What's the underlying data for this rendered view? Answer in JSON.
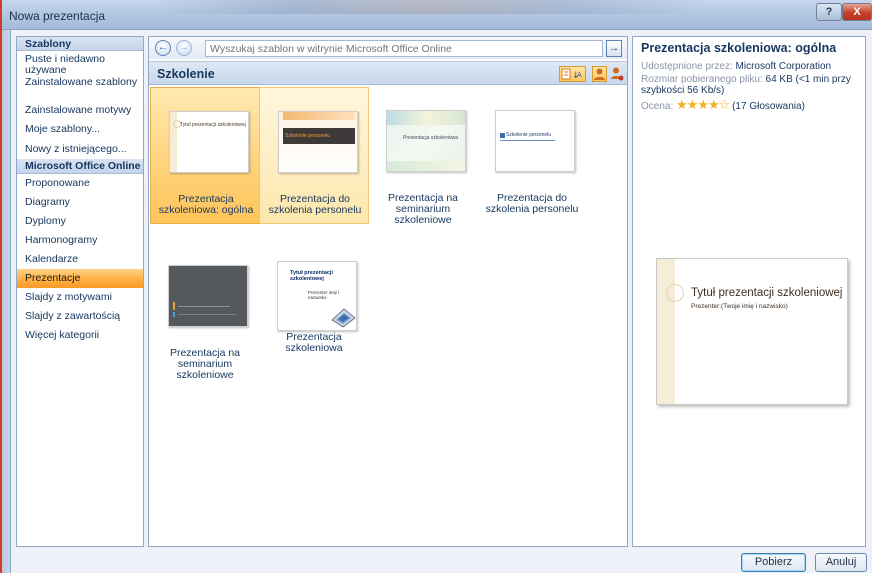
{
  "window": {
    "title": "Nowa prezentacja",
    "help": "?",
    "close": "X"
  },
  "nav": {
    "header1": "Szablony",
    "items1": [
      "Puste i niedawno używane",
      "Zainstalowane szablony",
      "Zainstalowane motywy",
      "Moje szablony...",
      "Nowy z istniejącego..."
    ],
    "header2": "Microsoft Office Online",
    "items2": [
      "Proponowane",
      "Diagramy",
      "Dyplomy",
      "Harmonogramy",
      "Kalendarze",
      "Prezentacje",
      "Slajdy z motywami",
      "Slajdy z zawartością",
      "Więcej kategorii"
    ],
    "selected": "Prezentacje"
  },
  "toolbar": {
    "back": "←",
    "forward": "→",
    "search_placeholder": "Wyszukaj szablon w witrynie Microsoft Office Online",
    "go": "→"
  },
  "section": {
    "title": "Szkolenie"
  },
  "templates": [
    {
      "label": "Prezentacja szkoleniowa: ogólna"
    },
    {
      "label": "Prezentacja do szkolenia personelu"
    },
    {
      "label": "Prezentacja na seminarium szkoleniowe"
    },
    {
      "label": "Prezentacja do szkolenia personelu"
    },
    {
      "label": "Prezentacja na seminarium szkoleniowe"
    },
    {
      "label": "Prezentacja szkoleniowa"
    }
  ],
  "thumbs": {
    "t1_title": "Tytuł prezentacji szkoleniowej",
    "t2_bar": "Szkolenie personelu",
    "t3_title": "Prezentacja szkoleniowa",
    "t4_title": "Szkolenie personelu",
    "t6_title": "Tytuł prezentacji szkoleniowej",
    "t6_sub": "Prezenter imię i nazwisko"
  },
  "details": {
    "title": "Prezentacja szkoleniowa: ogólna",
    "provided_label": "Udostępnione przez:",
    "provided_value": "Microsoft Corporation",
    "size_label": "Rozmiar pobieranego pliku:",
    "size_value": "64 KB (<1 min przy szybkości 56 Kb/s)",
    "rating_label": "Ocena:",
    "rating_stars": "★★★★☆",
    "rating_votes": "(17 Głosowania)",
    "preview_title": "Tytuł prezentacji szkoleniowej",
    "preview_sub": "Prezenter:(Twoje imię i nazwisko)"
  },
  "buttons": {
    "download": "Pobierz",
    "cancel": "Anuluj"
  }
}
